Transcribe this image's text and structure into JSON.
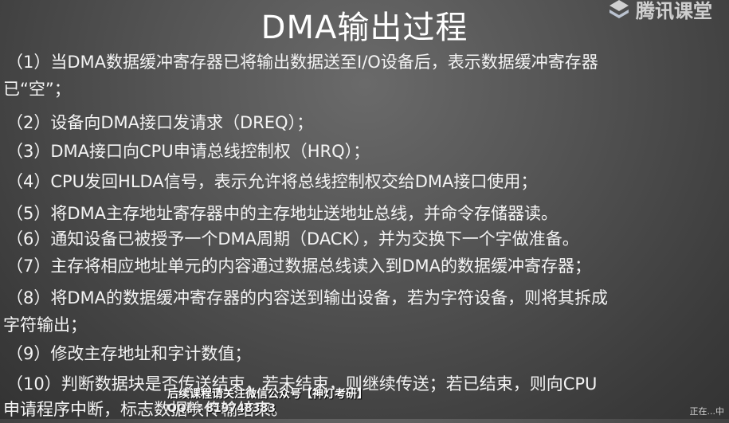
{
  "slide": {
    "title": "DMA输出过程",
    "steps": [
      "（1）当DMA数据缓冲寄存器已将输出数据送至I/O设备后，表示数据缓冲寄存器",
      "已“空”；",
      "（2）设备向DMA接口发请求（DREQ）；",
      "（3）DMA接口向CPU申请总线控制权（HRQ）；",
      "（4）CPU发回HLDA信号，表示允许将总线控制权交给DMA接口使用；",
      "（5）将DMA主存地址寄存器中的主存地址送地址总线，并命令存储器读。",
      "（6）通知设备已被授予一个DMA周期（DACK），并为交换下一个字做准备。",
      "（7）主存将相应地址单元的内容通过数据总线读入到DMA的数据缓冲寄存器；",
      "（8）将DMA的数据缓冲寄存器的内容送到输出设备，若为字符设备，则将其拆成",
      "字符输出；",
      "（9）修改主存地址和字计数值；",
      "（10）判断数据块是否传送结束，若未结束，则继续传送；若已结束，则向CPU",
      "申请程序中断，标志数据块传输结束。"
    ]
  },
  "logo": {
    "text": "腾讯课堂",
    "icon": "tencent-classroom-logo-icon"
  },
  "watermark": {
    "line1": "后续课程请关注微信公众号【神灯考研】",
    "line2": "QQ群: 819748383"
  },
  "corner": {
    "text": "正在...中"
  },
  "colors": {
    "text": "#f4f4f4",
    "background_center": "#6a6a6a",
    "background_edge": "#333333"
  }
}
